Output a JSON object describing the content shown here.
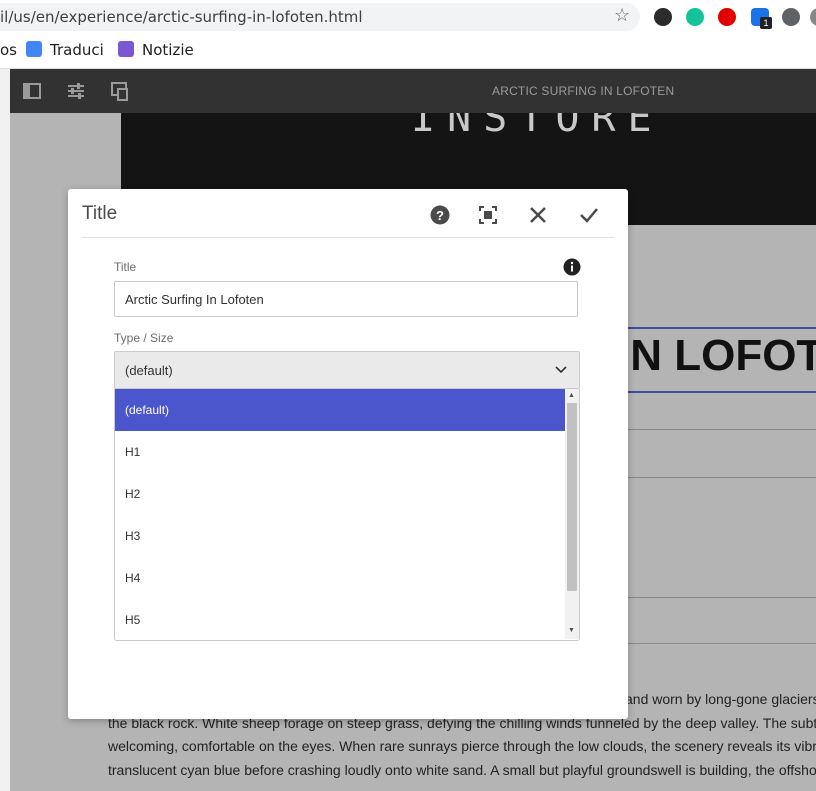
{
  "browser": {
    "url": "il/us/en/experience/arctic-surfing-in-lofoten.html",
    "bookmarks": [
      {
        "label": "os"
      },
      {
        "label": "Traduci"
      },
      {
        "label": "Notizie"
      }
    ],
    "extension_badge": "1"
  },
  "editor": {
    "page_title": "ARCTIC SURFING IN LOFOTEN"
  },
  "page": {
    "hero_text": "INSTORE",
    "big_title": "IN LOFOT",
    "body_lines": [
      "and worn by long-gone glaciers",
      "the black rock. White sheep forage on steep grass, defying the chilling winds funneled by the deep valley. The subtle",
      "welcoming, comfortable on the eyes. When rare sunrays pierce through the low clouds, the scenery reveals its vibra",
      "translucent cyan blue before crashing loudly onto white sand. A small but playful groundswell is building, the offshor"
    ]
  },
  "dialog": {
    "title": "Title",
    "title_field": {
      "label": "Title",
      "value": "Arctic Surfing In Lofoten"
    },
    "type_field": {
      "label": "Type / Size",
      "selected": "(default)",
      "options": [
        "(default)",
        "H1",
        "H2",
        "H3",
        "H4",
        "H5"
      ]
    }
  },
  "colors": {
    "accent_selected": "#4b55cc",
    "editor_bar": "#323232",
    "title_rule": "#3f4e9c"
  }
}
